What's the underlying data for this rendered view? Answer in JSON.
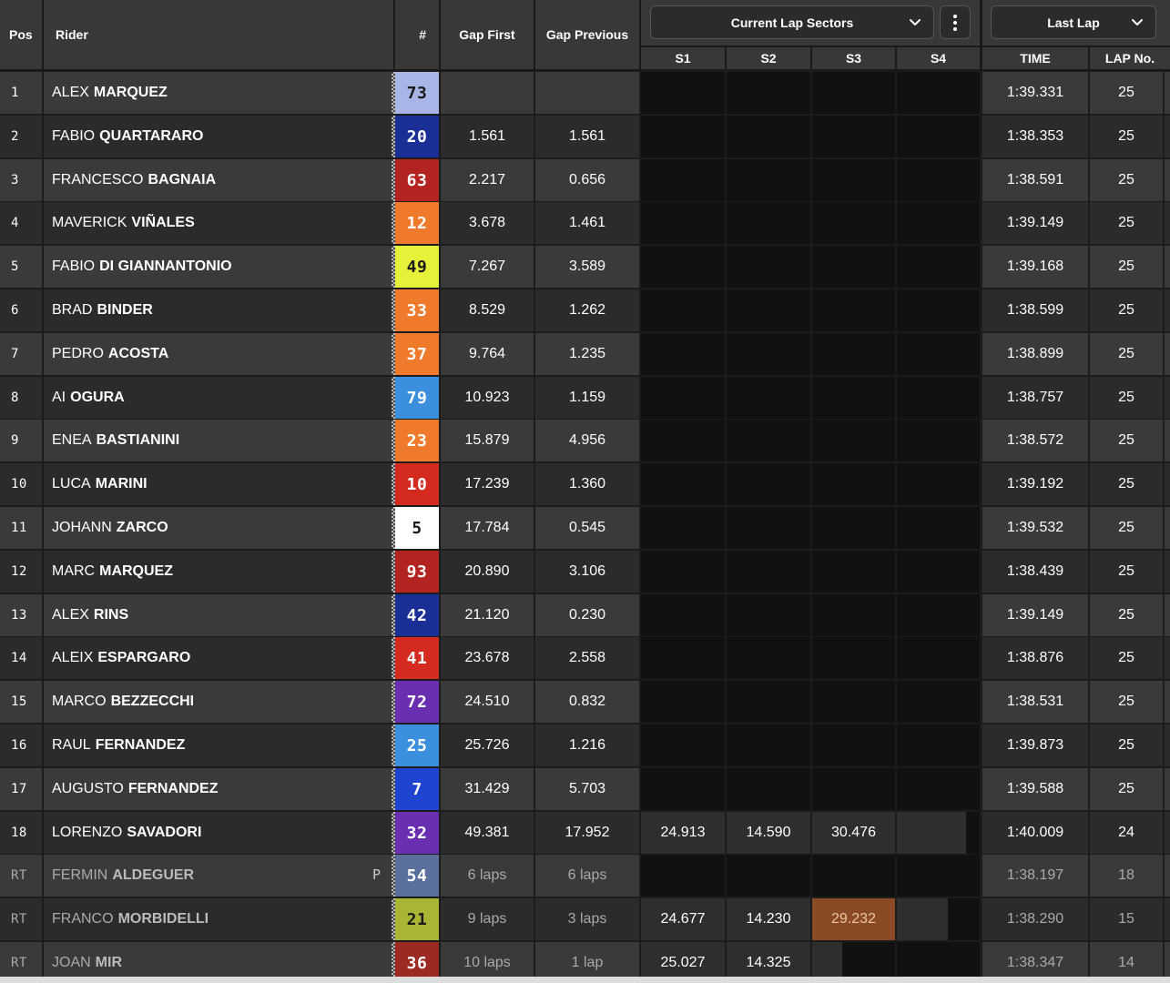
{
  "header": {
    "pos": "Pos",
    "rider": "Rider",
    "number": "#",
    "gap_first": "Gap First",
    "gap_previous": "Gap Previous",
    "sectors_dropdown": "Current Lap Sectors",
    "lap_dropdown": "Last Lap",
    "s1": "S1",
    "s2": "S2",
    "s3": "S3",
    "s4": "S4",
    "time": "TIME",
    "lap_no": "LAP No."
  },
  "colors": {
    "header_bg": "#383838",
    "row_even": "#3a3a3a",
    "row_odd": "#2b2b2b",
    "sector_bg": "#111111",
    "sector_highlight": "#8a4a26"
  },
  "rows": [
    {
      "pos": "1",
      "first": "ALEX",
      "last": "MARQUEZ",
      "num": "73",
      "num_bg": "#a7b6e6",
      "num_fg": "#1a1a1a",
      "gap_first": "",
      "gap_prev": "",
      "s1": "",
      "s2": "",
      "s3": "",
      "s4": "",
      "time": "1:39.331",
      "lap": "25",
      "tag": ""
    },
    {
      "pos": "2",
      "first": "FABIO",
      "last": "QUARTARARO",
      "num": "20",
      "num_bg": "#1a2f96",
      "num_fg": "#ffffff",
      "gap_first": "1.561",
      "gap_prev": "1.561",
      "s1": "",
      "s2": "",
      "s3": "",
      "s4": "",
      "time": "1:38.353",
      "lap": "25",
      "tag": ""
    },
    {
      "pos": "3",
      "first": "FRANCESCO",
      "last": "BAGNAIA",
      "num": "63",
      "num_bg": "#b3231f",
      "num_fg": "#ffffff",
      "gap_first": "2.217",
      "gap_prev": "0.656",
      "s1": "",
      "s2": "",
      "s3": "",
      "s4": "",
      "time": "1:38.591",
      "lap": "25",
      "tag": ""
    },
    {
      "pos": "4",
      "first": "MAVERICK",
      "last": "VIÑALES",
      "num": "12",
      "num_bg": "#f07a2b",
      "num_fg": "#ffffff",
      "gap_first": "3.678",
      "gap_prev": "1.461",
      "s1": "",
      "s2": "",
      "s3": "",
      "s4": "",
      "time": "1:39.149",
      "lap": "25",
      "tag": ""
    },
    {
      "pos": "5",
      "first": "FABIO",
      "last": "DI GIANNANTONIO",
      "num": "49",
      "num_bg": "#e6f23a",
      "num_fg": "#1a1a1a",
      "gap_first": "7.267",
      "gap_prev": "3.589",
      "s1": "",
      "s2": "",
      "s3": "",
      "s4": "",
      "time": "1:39.168",
      "lap": "25",
      "tag": ""
    },
    {
      "pos": "6",
      "first": "BRAD",
      "last": "BINDER",
      "num": "33",
      "num_bg": "#f07a2b",
      "num_fg": "#ffffff",
      "gap_first": "8.529",
      "gap_prev": "1.262",
      "s1": "",
      "s2": "",
      "s3": "",
      "s4": "",
      "time": "1:38.599",
      "lap": "25",
      "tag": ""
    },
    {
      "pos": "7",
      "first": "PEDRO",
      "last": "ACOSTA",
      "num": "37",
      "num_bg": "#f07a2b",
      "num_fg": "#ffffff",
      "gap_first": "9.764",
      "gap_prev": "1.235",
      "s1": "",
      "s2": "",
      "s3": "",
      "s4": "",
      "time": "1:38.899",
      "lap": "25",
      "tag": ""
    },
    {
      "pos": "8",
      "first": "AI",
      "last": "OGURA",
      "num": "79",
      "num_bg": "#3b8fdc",
      "num_fg": "#ffffff",
      "gap_first": "10.923",
      "gap_prev": "1.159",
      "s1": "",
      "s2": "",
      "s3": "",
      "s4": "",
      "time": "1:38.757",
      "lap": "25",
      "tag": ""
    },
    {
      "pos": "9",
      "first": "ENEA",
      "last": "BASTIANINI",
      "num": "23",
      "num_bg": "#f07a2b",
      "num_fg": "#ffffff",
      "gap_first": "15.879",
      "gap_prev": "4.956",
      "s1": "",
      "s2": "",
      "s3": "",
      "s4": "",
      "time": "1:38.572",
      "lap": "25",
      "tag": ""
    },
    {
      "pos": "10",
      "first": "LUCA",
      "last": "MARINI",
      "num": "10",
      "num_bg": "#d42a20",
      "num_fg": "#ffffff",
      "gap_first": "17.239",
      "gap_prev": "1.360",
      "s1": "",
      "s2": "",
      "s3": "",
      "s4": "",
      "time": "1:39.192",
      "lap": "25",
      "tag": ""
    },
    {
      "pos": "11",
      "first": "JOHANN",
      "last": "ZARCO",
      "num": "5",
      "num_bg": "#ffffff",
      "num_fg": "#1a1a1a",
      "gap_first": "17.784",
      "gap_prev": "0.545",
      "s1": "",
      "s2": "",
      "s3": "",
      "s4": "",
      "time": "1:39.532",
      "lap": "25",
      "tag": ""
    },
    {
      "pos": "12",
      "first": "MARC",
      "last": "MARQUEZ",
      "num": "93",
      "num_bg": "#b3231f",
      "num_fg": "#ffffff",
      "gap_first": "20.890",
      "gap_prev": "3.106",
      "s1": "",
      "s2": "",
      "s3": "",
      "s4": "",
      "time": "1:38.439",
      "lap": "25",
      "tag": ""
    },
    {
      "pos": "13",
      "first": "ALEX",
      "last": "RINS",
      "num": "42",
      "num_bg": "#1a2f96",
      "num_fg": "#ffffff",
      "gap_first": "21.120",
      "gap_prev": "0.230",
      "s1": "",
      "s2": "",
      "s3": "",
      "s4": "",
      "time": "1:39.149",
      "lap": "25",
      "tag": ""
    },
    {
      "pos": "14",
      "first": "ALEIX",
      "last": "ESPARGARO",
      "num": "41",
      "num_bg": "#d42a20",
      "num_fg": "#ffffff",
      "gap_first": "23.678",
      "gap_prev": "2.558",
      "s1": "",
      "s2": "",
      "s3": "",
      "s4": "",
      "time": "1:38.876",
      "lap": "25",
      "tag": ""
    },
    {
      "pos": "15",
      "first": "MARCO",
      "last": "BEZZECCHI",
      "num": "72",
      "num_bg": "#6a2fb0",
      "num_fg": "#ffffff",
      "gap_first": "24.510",
      "gap_prev": "0.832",
      "s1": "",
      "s2": "",
      "s3": "",
      "s4": "",
      "time": "1:38.531",
      "lap": "25",
      "tag": ""
    },
    {
      "pos": "16",
      "first": "RAUL",
      "last": "FERNANDEZ",
      "num": "25",
      "num_bg": "#3b8fdc",
      "num_fg": "#ffffff",
      "gap_first": "25.726",
      "gap_prev": "1.216",
      "s1": "",
      "s2": "",
      "s3": "",
      "s4": "",
      "time": "1:39.873",
      "lap": "25",
      "tag": ""
    },
    {
      "pos": "17",
      "first": "AUGUSTO",
      "last": "FERNANDEZ",
      "num": "7",
      "num_bg": "#1f45d0",
      "num_fg": "#ffffff",
      "gap_first": "31.429",
      "gap_prev": "5.703",
      "s1": "",
      "s2": "",
      "s3": "",
      "s4": "",
      "time": "1:39.588",
      "lap": "25",
      "tag": ""
    },
    {
      "pos": "18",
      "first": "LORENZO",
      "last": "SAVADORI",
      "num": "32",
      "num_bg": "#6a2fb0",
      "num_fg": "#ffffff",
      "gap_first": "49.381",
      "gap_prev": "17.952",
      "s1": "24.913",
      "s2": "14.590",
      "s3": "30.476",
      "s4": "",
      "time": "1:40.009",
      "lap": "24",
      "tag": ""
    },
    {
      "pos": "RT",
      "first": "FERMIN",
      "last": "ALDEGUER",
      "num": "54",
      "num_bg": "#5a6f9c",
      "num_fg": "#ffffff",
      "gap_first": "6 laps",
      "gap_prev": "6 laps",
      "s1": "",
      "s2": "",
      "s3": "",
      "s4": "",
      "time": "1:38.197",
      "lap": "18",
      "tag": "P"
    },
    {
      "pos": "RT",
      "first": "FRANCO",
      "last": "MORBIDELLI",
      "num": "21",
      "num_bg": "#aab536",
      "num_fg": "#1a1a1a",
      "gap_first": "9 laps",
      "gap_prev": "3 laps",
      "s1": "24.677",
      "s2": "14.230",
      "s3": "29.232",
      "s4": "",
      "time": "1:38.290",
      "lap": "15",
      "tag": ""
    },
    {
      "pos": "RT",
      "first": "JOAN",
      "last": "MIR",
      "num": "36",
      "num_bg": "#9c2a22",
      "num_fg": "#ffffff",
      "gap_first": "10 laps",
      "gap_prev": "1 lap",
      "s1": "25.027",
      "s2": "14.325",
      "s3": "",
      "s4": "",
      "time": "1:38.347",
      "lap": "14",
      "tag": ""
    }
  ]
}
